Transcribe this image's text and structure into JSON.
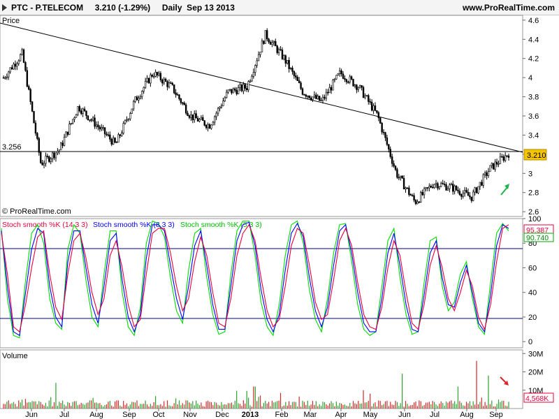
{
  "header": {
    "title": "PTC - P.TELECOM     3.210 (-1.29%)     Daily  Sep 13 2013",
    "site": "www.ProRealTime.com",
    "copyright": "© ProRealTime.com"
  },
  "colors": {
    "stoch_14": "#e8003c",
    "stoch_8": "#0000ff",
    "stoch_5": "#00dd00",
    "volume_up": "#2ca02c",
    "volume_down": "#d62728",
    "level_line": "#00008b",
    "arrow_up": "#22b14c",
    "arrow_down": "#e0232a"
  },
  "chart_data": [
    {
      "type": "candlestick",
      "title": "Price",
      "ylim": [
        2.55,
        4.65
      ],
      "y_ticks": [
        "4.6",
        "4.4",
        "4.2",
        "4",
        "3.8",
        "3.6",
        "3.4",
        "3.2",
        "3",
        "2.8",
        "2.6"
      ],
      "horizontal_level": {
        "value": 3.256,
        "label": "3.256"
      },
      "last_value_label": "3.210",
      "trendline": {
        "from": [
          "May 2012",
          4.56
        ],
        "to": [
          "Sep 13 2013",
          3.23
        ]
      },
      "price_path": [
        [
          "May 2012",
          4.0
        ],
        [
          "late May",
          4.25
        ],
        [
          "Jun",
          3.1
        ],
        [
          "mid Jun",
          3.25
        ],
        [
          "Jul",
          3.7
        ],
        [
          "late Jul",
          3.5
        ],
        [
          "Aug",
          3.3
        ],
        [
          "mid Aug",
          3.75
        ],
        [
          "Sep",
          4.05
        ],
        [
          "Oct",
          3.9
        ],
        [
          "Nov",
          3.6
        ],
        [
          "mid Nov",
          3.5
        ],
        [
          "Dec",
          3.85
        ],
        [
          "late Dec",
          3.9
        ],
        [
          "Jan 2013",
          4.45
        ],
        [
          "Feb",
          4.2
        ],
        [
          "Mar",
          3.85
        ],
        [
          "Apr",
          3.75
        ],
        [
          "mid Apr",
          4.05
        ],
        [
          "May",
          3.9
        ],
        [
          "Jun",
          3.6
        ],
        [
          "mid Jun",
          3.0
        ],
        [
          "Jul",
          2.7
        ],
        [
          "late Jul",
          2.9
        ],
        [
          "Aug",
          2.85
        ],
        [
          "late Aug",
          2.75
        ],
        [
          "Sep",
          3.05
        ],
        [
          "Sep 13 2013",
          3.21
        ]
      ]
    },
    {
      "type": "line",
      "legend": [
        "Stoch smooth %K (14 3 3)",
        "Stoch smooth %K (8 3 3)",
        "Stoch smooth %K (5 3 3)"
      ],
      "ylim": [
        -5,
        100
      ],
      "y_ticks": [
        "100",
        "80",
        "60",
        "40",
        "20",
        "0"
      ],
      "levels": [
        20,
        80
      ],
      "last_values": {
        "k14": "95.387",
        "k8": "90.740"
      },
      "series": [
        {
          "name": "Stoch smooth %K (14 3 3)",
          "values": [
            88,
            55,
            12,
            8,
            30,
            60,
            85,
            90,
            55,
            28,
            18,
            55,
            82,
            88,
            68,
            40,
            22,
            35,
            70,
            82,
            60,
            30,
            12,
            18,
            55,
            88,
            92,
            92,
            72,
            45,
            25,
            35,
            65,
            85,
            70,
            40,
            15,
            12,
            35,
            70,
            88,
            95,
            82,
            52,
            25,
            12,
            18,
            45,
            78,
            92,
            88,
            62,
            32,
            18,
            22,
            50,
            82,
            92,
            78,
            48,
            22,
            12,
            10,
            28,
            60,
            82,
            70,
            40,
            15,
            10,
            30,
            62,
            78,
            60,
            35,
            25,
            40,
            58,
            45,
            20,
            10,
            30,
            65,
            92,
            95
          ]
        },
        {
          "name": "Stoch smooth %K (8 3 3)",
          "values": [
            90,
            45,
            8,
            5,
            40,
            75,
            92,
            88,
            45,
            20,
            12,
            65,
            90,
            90,
            60,
            30,
            15,
            45,
            82,
            88,
            50,
            20,
            8,
            22,
            68,
            95,
            95,
            90,
            62,
            35,
            18,
            45,
            78,
            90,
            62,
            30,
            10,
            10,
            45,
            82,
            95,
            97,
            78,
            42,
            18,
            8,
            22,
            58,
            88,
            96,
            85,
            52,
            25,
            12,
            28,
            62,
            90,
            95,
            72,
            40,
            15,
            8,
            8,
            35,
            72,
            88,
            62,
            30,
            10,
            8,
            38,
            72,
            82,
            52,
            30,
            28,
            48,
            62,
            40,
            15,
            8,
            38,
            78,
            95,
            92
          ]
        },
        {
          "name": "Stoch smooth %K (5 3 3)",
          "values": [
            92,
            35,
            5,
            3,
            50,
            88,
            95,
            80,
            35,
            15,
            10,
            75,
            95,
            88,
            50,
            20,
            12,
            55,
            90,
            90,
            40,
            12,
            5,
            28,
            80,
            98,
            96,
            85,
            52,
            25,
            15,
            58,
            88,
            92,
            52,
            22,
            6,
            8,
            55,
            90,
            98,
            98,
            70,
            32,
            12,
            5,
            30,
            70,
            95,
            98,
            80,
            42,
            18,
            8,
            35,
            72,
            95,
            96,
            65,
            30,
            10,
            5,
            8,
            45,
            82,
            92,
            52,
            22,
            6,
            8,
            48,
            82,
            85,
            45,
            25,
            32,
            55,
            65,
            35,
            12,
            6,
            48,
            88,
            96,
            90
          ]
        }
      ]
    },
    {
      "type": "bar",
      "title": "Volume",
      "ylim": [
        0,
        32
      ],
      "y_ticks": [
        "30M",
        "20M",
        "10M"
      ],
      "last_value_label": "4,568K",
      "peak_values_M": {
        "Jan": 14,
        "Jun": 19,
        "Aug": 12,
        "late Aug": 26,
        "Sep": 18
      }
    }
  ],
  "x_axis": {
    "labels": [
      "Jun",
      "Jul",
      "Aug",
      "Sep",
      "Oct",
      "Nov",
      "Dec",
      "2013",
      "Feb",
      "Mar",
      "Apr",
      "May",
      "Jun",
      "Jul",
      "Aug",
      "Sep"
    ]
  }
}
